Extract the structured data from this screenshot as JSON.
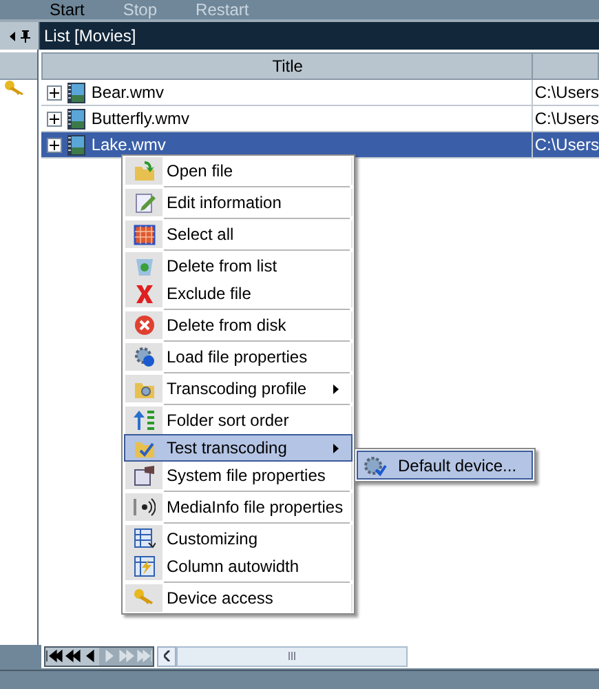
{
  "toolbar": [
    {
      "label": "Start",
      "disabled": false
    },
    {
      "label": "Stop",
      "disabled": true
    },
    {
      "label": "Restart",
      "disabled": true
    }
  ],
  "panel": {
    "title": "List [Movies]"
  },
  "table": {
    "columns": [
      "Title"
    ],
    "rows": [
      {
        "title": "Bear.wmv",
        "path": "C:\\Users",
        "selected": false
      },
      {
        "title": "Butterfly.wmv",
        "path": "C:\\Users",
        "selected": false
      },
      {
        "title": "Lake.wmv",
        "path": "C:\\Users",
        "selected": true
      }
    ]
  },
  "context_menu": {
    "groups": [
      [
        {
          "label": "Open file",
          "submenu": false,
          "selected": false
        }
      ],
      [
        {
          "label": "Edit information",
          "submenu": false,
          "selected": false
        }
      ],
      [
        {
          "label": "Select all",
          "submenu": false,
          "selected": false
        }
      ],
      [
        {
          "label": "Delete from list",
          "submenu": false,
          "selected": false
        },
        {
          "label": "Exclude file",
          "submenu": false,
          "selected": false
        }
      ],
      [
        {
          "label": "Delete from disk",
          "submenu": false,
          "selected": false
        }
      ],
      [
        {
          "label": "Load file properties",
          "submenu": false,
          "selected": false
        }
      ],
      [
        {
          "label": "Transcoding profile",
          "submenu": true,
          "selected": false
        }
      ],
      [
        {
          "label": "Folder sort order",
          "submenu": false,
          "selected": false
        },
        {
          "label": "Test transcoding",
          "submenu": true,
          "selected": true
        },
        {
          "label": "System file properties",
          "submenu": false,
          "selected": false
        }
      ],
      [
        {
          "label": "MediaInfo file properties",
          "submenu": false,
          "selected": false
        }
      ],
      [
        {
          "label": "Customizing",
          "submenu": false,
          "selected": false
        },
        {
          "label": "Column autowidth",
          "submenu": false,
          "selected": false
        }
      ],
      [
        {
          "label": "Device access",
          "submenu": false,
          "selected": false
        }
      ]
    ]
  },
  "submenu": {
    "items": [
      {
        "label": "Default device...",
        "selected": true
      }
    ]
  },
  "navigator": [
    {
      "disabled": false
    },
    {
      "disabled": false
    },
    {
      "disabled": false
    },
    {
      "disabled": true
    },
    {
      "disabled": true
    },
    {
      "disabled": true
    }
  ]
}
